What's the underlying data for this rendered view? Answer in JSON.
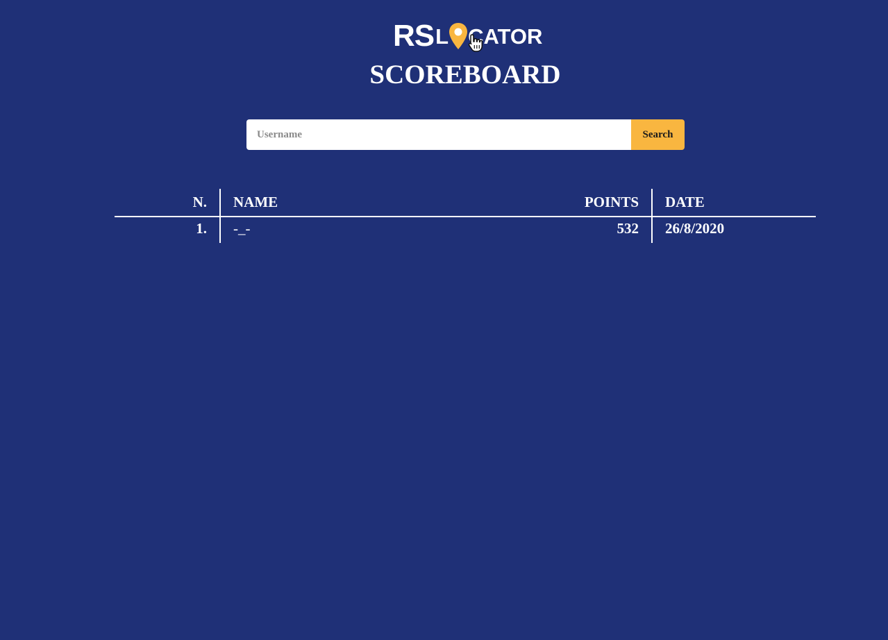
{
  "logo": {
    "part_rs": "RS",
    "part_l": "L",
    "part_cator": "CATOR",
    "pin_icon": "location-pin-icon",
    "accent": "#f9b640"
  },
  "page": {
    "title": "SCOREBOARD",
    "background": "#1f3077"
  },
  "search": {
    "placeholder": "Username",
    "value": "",
    "button_label": "Search",
    "button_color": "#f9b640"
  },
  "table": {
    "columns": [
      "N.",
      "NAME",
      "POINTS",
      "DATE"
    ],
    "rows": [
      {
        "n": "1.",
        "name": "-_-",
        "points": "532",
        "date": "26/8/2020"
      }
    ]
  },
  "cursor": {
    "icon": "hand-pointer-icon"
  }
}
